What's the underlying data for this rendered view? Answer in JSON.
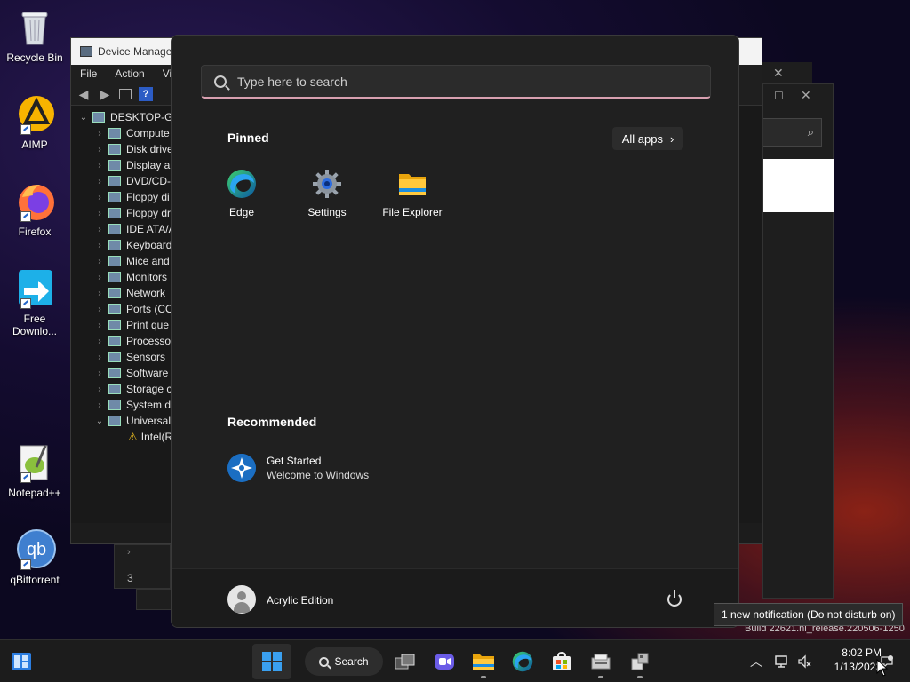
{
  "desktop_icons": [
    {
      "label": "Recycle Bin",
      "icon": "recycle-bin-icon"
    },
    {
      "label": "AIMP",
      "icon": "aimp-icon"
    },
    {
      "label": "Firefox",
      "icon": "firefox-icon"
    },
    {
      "label": "Free Downlo...",
      "icon": "free-download-manager-icon"
    },
    {
      "label": "Notepad++",
      "icon": "notepad-plus-plus-icon"
    },
    {
      "label": "qBittorrent",
      "icon": "qbittorrent-icon"
    }
  ],
  "device_manager": {
    "title": "Device Manager",
    "menu": [
      "File",
      "Action",
      "View"
    ],
    "tree_root": "DESKTOP-GO",
    "tree_items": [
      "Compute",
      "Disk drive",
      "Display a",
      "DVD/CD-",
      "Floppy di",
      "Floppy dr",
      "IDE ATA/A",
      "Keyboard",
      "Mice and",
      "Monitors",
      "Network",
      "Ports (CO",
      "Print que",
      "Processo",
      "Sensors",
      "Software",
      "Storage c",
      "System d",
      "Universal"
    ],
    "tree_child": "Intel(R"
  },
  "background_window": {
    "build_text": "Build 22621.ni_release.220506-1250",
    "row_numbers": [
      "3"
    ]
  },
  "start_menu": {
    "search_placeholder": "Type here to search",
    "pinned_title": "Pinned",
    "all_apps_label": "All apps",
    "pinned_apps": [
      {
        "label": "Edge",
        "icon": "edge-icon"
      },
      {
        "label": "Settings",
        "icon": "settings-gear-icon"
      },
      {
        "label": "File Explorer",
        "icon": "folder-icon"
      }
    ],
    "recommended_title": "Recommended",
    "recommended": [
      {
        "title": "Get Started",
        "subtitle": "Welcome to Windows",
        "icon": "get-started-icon"
      }
    ],
    "user_name": "Acrylic Edition",
    "power_icon": "power-icon"
  },
  "tooltip": "1 new notification (Do not disturb on)",
  "taskbar": {
    "search_label": "Search",
    "apps": [
      "start-icon",
      "search",
      "task-view-icon",
      "chat-icon",
      "file-explorer-icon",
      "edge-icon",
      "store-icon",
      "device-manager-icon",
      "installer-icon"
    ],
    "clock_time": "8:02 PM",
    "clock_date": "1/13/2023"
  },
  "colors": {
    "accent": "#3aa0f0",
    "start_bg": "#202020",
    "search_underline": "#d8a0b0",
    "taskbar_bg": "#1c1c1c"
  }
}
